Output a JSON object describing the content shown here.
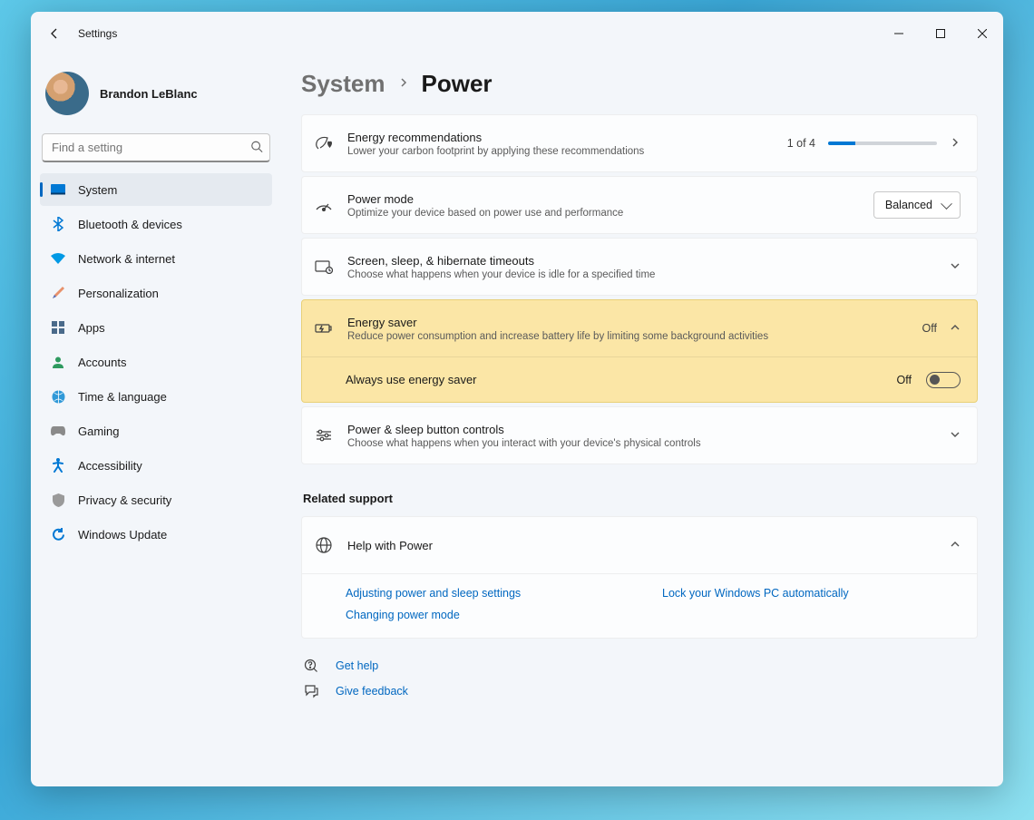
{
  "window": {
    "title": "Settings"
  },
  "profile": {
    "name": "Brandon LeBlanc"
  },
  "search": {
    "placeholder": "Find a setting"
  },
  "sidebar": {
    "items": [
      {
        "key": "system",
        "label": "System",
        "active": true
      },
      {
        "key": "bluetooth",
        "label": "Bluetooth & devices"
      },
      {
        "key": "network",
        "label": "Network & internet"
      },
      {
        "key": "personalization",
        "label": "Personalization"
      },
      {
        "key": "apps",
        "label": "Apps"
      },
      {
        "key": "accounts",
        "label": "Accounts"
      },
      {
        "key": "time",
        "label": "Time & language"
      },
      {
        "key": "gaming",
        "label": "Gaming"
      },
      {
        "key": "accessibility",
        "label": "Accessibility"
      },
      {
        "key": "privacy",
        "label": "Privacy & security"
      },
      {
        "key": "update",
        "label": "Windows Update"
      }
    ]
  },
  "breadcrumb": {
    "parent": "System",
    "current": "Power"
  },
  "cards": {
    "energy_rec": {
      "title": "Energy recommendations",
      "sub": "Lower your carbon footprint by applying these recommendations",
      "progress_text": "1 of 4"
    },
    "power_mode": {
      "title": "Power mode",
      "sub": "Optimize your device based on power use and performance",
      "value": "Balanced"
    },
    "timeouts": {
      "title": "Screen, sleep, & hibernate timeouts",
      "sub": "Choose what happens when your device is idle for a specified time"
    },
    "energy_saver": {
      "title": "Energy saver",
      "sub": "Reduce power consumption and increase battery life by limiting some background activities",
      "status": "Off",
      "subrow_label": "Always use energy saver",
      "subrow_status": "Off"
    },
    "buttons": {
      "title": "Power & sleep button controls",
      "sub": "Choose what happens when you interact with your device's physical controls"
    }
  },
  "related": {
    "heading": "Related support",
    "help_title": "Help with Power",
    "links": {
      "a": "Adjusting power and sleep settings",
      "b": "Lock your Windows PC automatically",
      "c": "Changing power mode"
    }
  },
  "footer": {
    "get_help": "Get help",
    "feedback": "Give feedback"
  }
}
